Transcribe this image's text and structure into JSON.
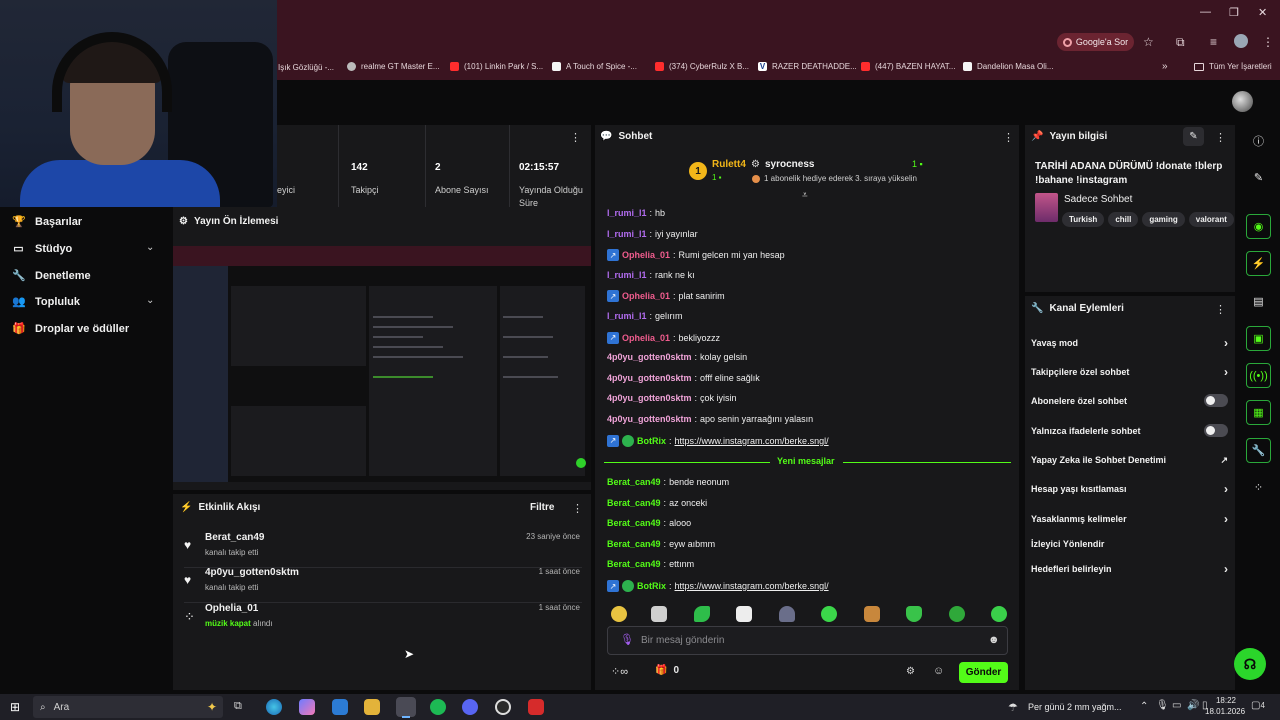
{
  "browser": {
    "google_chip": "Google'a Sor",
    "bookmarks": [
      {
        "label": "Işık Gözlüğü -...",
        "icon": "page-icon"
      },
      {
        "label": "realme GT Master E...",
        "icon": "globe-icon"
      },
      {
        "label": "(101) Linkin Park / S...",
        "icon": "youtube-icon"
      },
      {
        "label": "A Touch of Spice -...",
        "icon": "page-icon"
      },
      {
        "label": "(374) CyberRulz X B...",
        "icon": "youtube-icon"
      },
      {
        "label": "RAZER DEATHADDE...",
        "icon": "v-icon"
      },
      {
        "label": "(447) BAZEN HAYAT...",
        "icon": "youtube-icon"
      },
      {
        "label": "Dandelion Masa Oli...",
        "icon": "page-icon"
      }
    ],
    "all_bookmarks": "Tüm Yer İşaretleri",
    "accent": "#3a1420"
  },
  "nav": {
    "items": [
      {
        "label": "Başarılar",
        "icon": "trophy-icon"
      },
      {
        "label": "Stüdyo",
        "icon": "studio-icon"
      },
      {
        "label": "Denetleme",
        "icon": "wrench-icon"
      },
      {
        "label": "Topluluk",
        "icon": "community-icon"
      },
      {
        "label": "Droplar ve ödüller",
        "icon": "gift-icon"
      }
    ]
  },
  "stats": {
    "items": [
      {
        "value": "",
        "label": "eyici"
      },
      {
        "value": "142",
        "label": "Takipçi"
      },
      {
        "value": "2",
        "label": "Abone Sayısı"
      },
      {
        "value": "02:15:57",
        "label": "Yayında Olduğu Süre"
      }
    ]
  },
  "preview": {
    "title": "Yayın Ön İzlemesi"
  },
  "activity": {
    "title": "Etkinlik Akışı",
    "filter": "Filtre",
    "events": [
      {
        "name": "Berat_can49",
        "sub": "kanalı takip etti",
        "time": "23 saniye önce",
        "icon": "heart-icon"
      },
      {
        "name": "4p0yu_gotten0sktm",
        "sub": "kanalı takip etti",
        "time": "1 saat önce",
        "icon": "heart-icon"
      },
      {
        "name": "Ophelia_01",
        "sub_highlight": "müzik kapat",
        "sub_rest": "alındı",
        "time": "1 saat önce",
        "icon": "points-icon"
      }
    ]
  },
  "chat": {
    "title": "Sohbet",
    "leader_name": "Rulett4",
    "leader_rank": "1",
    "leader_count": "1",
    "gifter_name": "syrocness",
    "gifter_count": "1",
    "gifter_note": "1 abonelik hediye ederek 3. sıraya yükselin",
    "messages": [
      {
        "user": "l_rumi_l1",
        "text": "hb",
        "color": "#b26cf0",
        "badges": []
      },
      {
        "user": "l_rumi_l1",
        "text": "iyi yayınlar",
        "color": "#b26cf0",
        "badges": []
      },
      {
        "user": "Ophelia_01",
        "text": "Rumi gelcen mi yan hesap",
        "color": "#f05c8e",
        "badges": [
          "blue"
        ]
      },
      {
        "user": "l_rumi_l1",
        "text": "rank ne kı",
        "color": "#b26cf0",
        "badges": []
      },
      {
        "user": "Ophelia_01",
        "text": "plat sanirim",
        "color": "#f05c8e",
        "badges": [
          "blue"
        ]
      },
      {
        "user": "l_rumi_l1",
        "text": "gelırım",
        "color": "#b26cf0",
        "badges": []
      },
      {
        "user": "Ophelia_01",
        "text": "bekliyozzz",
        "color": "#f05c8e",
        "badges": [
          "blue"
        ]
      },
      {
        "user": "4p0yu_gotten0sktm",
        "text": "kolay gelsin",
        "color": "#f0a3d8",
        "badges": []
      },
      {
        "user": "4p0yu_gotten0sktm",
        "text": "offf eline sağlık",
        "color": "#f0a3d8",
        "badges": []
      },
      {
        "user": "4p0yu_gotten0sktm",
        "text": "çok iyisin",
        "color": "#f0a3d8",
        "badges": []
      },
      {
        "user": "4p0yu_gotten0sktm",
        "text": "apo senin yarraağını yalasın",
        "color": "#f0a3d8",
        "badges": []
      },
      {
        "user": "BotRix",
        "text": "https://www.instagram.com/berke.sngl/",
        "color": "#53fc18",
        "badges": [
          "blue",
          "green"
        ],
        "link": true
      }
    ],
    "new_messages": "Yeni mesajlar",
    "messages_after": [
      {
        "user": "Berat_can49",
        "text": "bende neonum",
        "color": "#53fc18",
        "badges": []
      },
      {
        "user": "Berat_can49",
        "text": "az onceki",
        "color": "#53fc18",
        "badges": []
      },
      {
        "user": "Berat_can49",
        "text": "alooo",
        "color": "#53fc18",
        "badges": []
      },
      {
        "user": "Berat_can49",
        "text": "eyw aıbmm",
        "color": "#53fc18",
        "badges": []
      },
      {
        "user": "Berat_can49",
        "text": "ettınm",
        "color": "#53fc18",
        "badges": []
      },
      {
        "user": "BotRix",
        "text": "https://www.instagram.com/berke.sngl/",
        "color": "#53fc18",
        "badges": [
          "blue",
          "green"
        ],
        "link": true
      }
    ],
    "input_placeholder": "Bir mesaj gönderin",
    "points_value": "∞",
    "gift_count": "0",
    "send_label": "Gönder"
  },
  "stream_info": {
    "title": "Yayın bilgisi",
    "stream_title": "TARİHİ ADANA DÜRÜMÜ !donate !blerp !bahane !instagram",
    "category": "Sadece Sohbet",
    "tags": [
      "Turkish",
      "chill",
      "gaming",
      "valorant"
    ]
  },
  "channel_actions": {
    "title": "Kanal Eylemleri",
    "rows": [
      {
        "label": "Yavaş mod",
        "control": "chevron"
      },
      {
        "label": "Takipçilere özel sohbet",
        "control": "chevron"
      },
      {
        "label": "Abonelere özel sohbet",
        "control": "toggle"
      },
      {
        "label": "Yalnızca ifadelerle sohbet",
        "control": "toggle"
      },
      {
        "label": "Yapay Zeka ile Sohbet Denetimi",
        "control": "external"
      },
      {
        "label": "Hesap yaşı kısıtlaması",
        "control": "chevron"
      },
      {
        "label": "Yasaklanmış kelimeler",
        "control": "chevron"
      },
      {
        "label": "İzleyici Yönlendir",
        "control": "none"
      },
      {
        "label": "Hedefleri belirleyin",
        "control": "chevron"
      }
    ]
  },
  "taskbar": {
    "search": "Ara",
    "weather": "Per günü 2 mm yağm...",
    "time": "18:22",
    "date": "18.01.2026",
    "notifications": "4"
  },
  "colors": {
    "brand": "#53fc18",
    "panel": "#18181a",
    "background": "#0b0b0c"
  }
}
